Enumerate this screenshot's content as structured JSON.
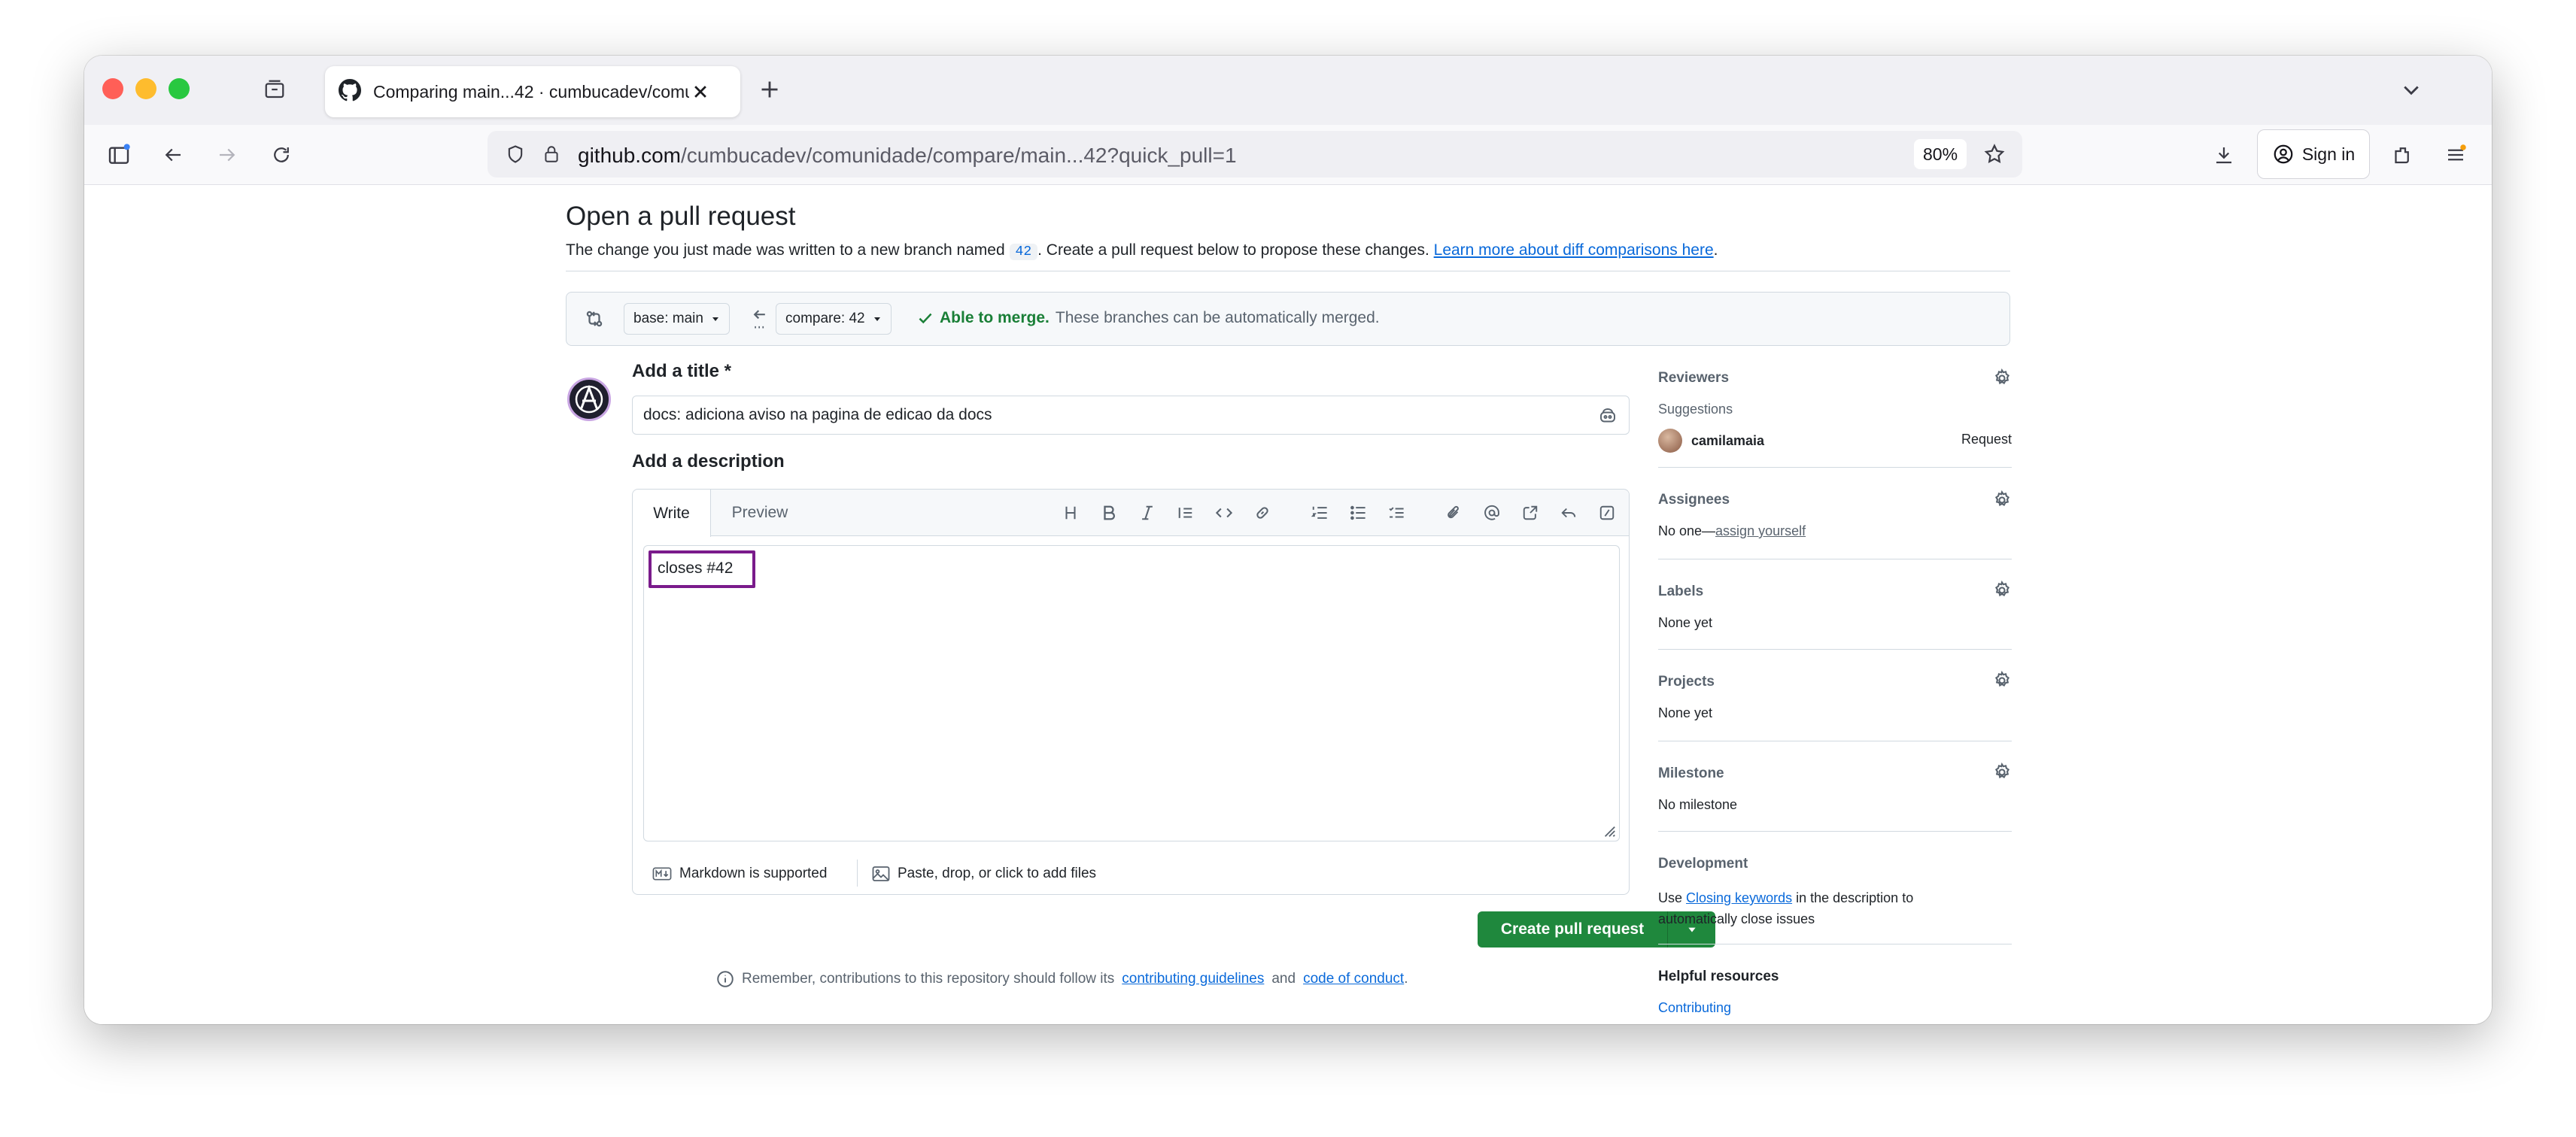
{
  "browser": {
    "tab_title": "Comparing main...42 · cumbucadev/comunidade",
    "url_host": "github.com",
    "url_path": "/cumbucadev/comunidade/compare/main...42?quick_pull=1",
    "zoom": "80%",
    "sign_in": "Sign in"
  },
  "page": {
    "heading": "Open a pull request",
    "sub_pre": "The change you just made was written to a new branch named",
    "branch_chip": "42",
    "sub_post": ". Create a pull request below to propose these changes.",
    "sub_link": "Learn more about diff comparisons here",
    "sub_end": "."
  },
  "compare": {
    "base": "base: main",
    "compare": "compare: 42",
    "ok": "Able to merge.",
    "msg": "These branches can be automatically merged."
  },
  "form": {
    "title_label": "Add a title *",
    "title_value": "docs: adiciona aviso na pagina de edicao da docs",
    "desc_label": "Add a description",
    "tab_write": "Write",
    "tab_preview": "Preview",
    "body": "closes #42",
    "markdown": "Markdown is supported",
    "attach": "Paste, drop, or click to add files",
    "create": "Create pull request",
    "remember_pre": "Remember, contributions to this repository should follow its",
    "remember_link1": "contributing guidelines",
    "remember_and": "and",
    "remember_link2": "code of conduct",
    "remember_end": "."
  },
  "sidebar": {
    "reviewers": "Reviewers",
    "suggestions": "Suggestions",
    "reviewer_name": "camilamaia",
    "request": "Request",
    "assignees": "Assignees",
    "assignees_pre": "No one—",
    "assignees_link": "assign yourself",
    "labels": "Labels",
    "labels_val": "None yet",
    "projects": "Projects",
    "projects_val": "None yet",
    "milestone": "Milestone",
    "milestone_val": "No milestone",
    "development": "Development",
    "dev_pre": "Use",
    "dev_link": "Closing keywords",
    "dev_post": "in the description to",
    "dev_line2": "automatically close issues",
    "helpful": "Helpful resources",
    "contributing": "Contributing"
  },
  "colors": {
    "primary_button": "#1f883d",
    "link": "#0969da",
    "merge_ok": "#1a7f37",
    "highlight_box": "#7a1b8b"
  }
}
